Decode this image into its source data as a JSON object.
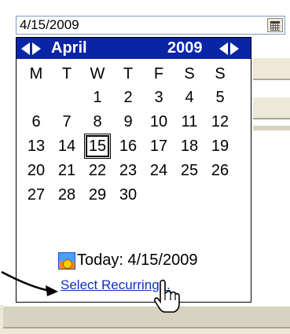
{
  "date_field": {
    "value": "4/15/2009"
  },
  "calendar": {
    "month": "April",
    "year": "2009",
    "weekdays": [
      "M",
      "T",
      "W",
      "T",
      "F",
      "S",
      "S"
    ],
    "weeks": [
      [
        "",
        "",
        "1",
        "2",
        "3",
        "4",
        "5"
      ],
      [
        "6",
        "7",
        "8",
        "9",
        "10",
        "11",
        "12"
      ],
      [
        "13",
        "14",
        "15",
        "16",
        "17",
        "18",
        "19"
      ],
      [
        "20",
        "21",
        "22",
        "23",
        "24",
        "25",
        "26"
      ],
      [
        "27",
        "28",
        "29",
        "30",
        "",
        "",
        ""
      ]
    ],
    "selected_day": "15",
    "today_label": "Today: 4/15/2009",
    "recurring_link": "Select Recurring..."
  },
  "colors": {
    "header_bg": "#0a24a8",
    "link": "#1030c0"
  },
  "icons": [
    "calendar-button-icon",
    "prev-month-arrow-icon",
    "next-month-arrow-icon",
    "today-icon",
    "hand-pointer-icon",
    "callout-arrow-icon"
  ]
}
